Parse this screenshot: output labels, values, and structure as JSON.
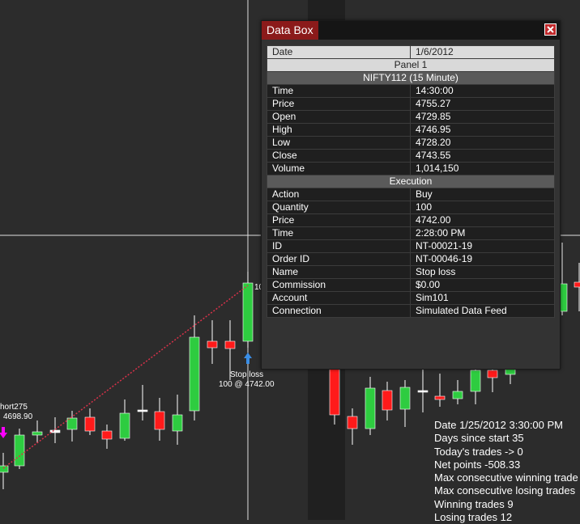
{
  "colors": {
    "background": "#2c2c2c",
    "up_candle": "#2ecc40",
    "down_candle": "#ff1a1a",
    "crosshair": "#e0e0e0",
    "trade_line": "#d9324a",
    "entry_arrow": "#ff00ff",
    "exit_arrow": "#3a8ee6",
    "title_accent": "#8b1a1a"
  },
  "chart": {
    "labels": {
      "short_entry_name": "hort275",
      "short_entry_price": "4698.90",
      "exit_name": "Stop loss",
      "exit_fill": "100 @ 4742.00",
      "truncated_qty": "10"
    }
  },
  "stats": {
    "lines": [
      "Date 1/25/2012 3:30:00 PM",
      "Days since start 35",
      "Today's trades -> 0",
      "Net points -508.33",
      "Max consecutive winning trade",
      "Max consecutive losing trades",
      "Winning trades 9",
      "Losing trades 12"
    ]
  },
  "databox": {
    "title": "Data Box",
    "close_icon": "close-icon",
    "header": {
      "label": "Date",
      "value": "1/6/2012"
    },
    "panel_title": "Panel 1",
    "instrument_title": "NIFTY112 (15 Minute)",
    "bar_rows": [
      {
        "label": "Time",
        "value": "14:30:00"
      },
      {
        "label": "Price",
        "value": "4755.27"
      },
      {
        "label": "Open",
        "value": "4729.85"
      },
      {
        "label": "High",
        "value": "4746.95"
      },
      {
        "label": "Low",
        "value": "4728.20"
      },
      {
        "label": "Close",
        "value": "4743.55"
      },
      {
        "label": "Volume",
        "value": "1,014,150"
      }
    ],
    "execution_title": "Execution",
    "execution_rows": [
      {
        "label": "Action",
        "value": "Buy"
      },
      {
        "label": "Quantity",
        "value": "100"
      },
      {
        "label": "Price",
        "value": "4742.00"
      },
      {
        "label": "Time",
        "value": "2:28:00 PM"
      },
      {
        "label": "ID",
        "value": "NT-00021-19"
      },
      {
        "label": "Order ID",
        "value": "NT-00046-19"
      },
      {
        "label": "Name",
        "value": "Stop loss"
      },
      {
        "label": "Commission",
        "value": "$0.00"
      },
      {
        "label": "Account",
        "value": "Sim101"
      },
      {
        "label": "Connection",
        "value": "Simulated Data Feed"
      }
    ]
  }
}
